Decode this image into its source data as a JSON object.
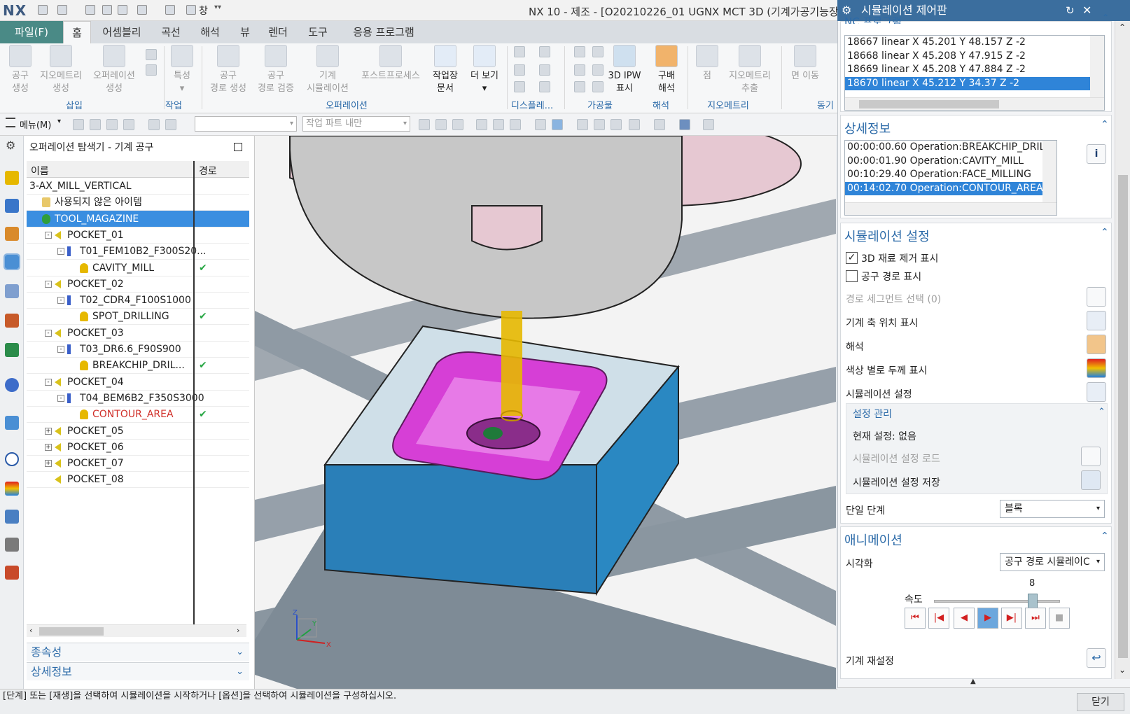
{
  "window": {
    "logo": "NX",
    "window_menu": "창",
    "title": "NX 10 - 제조 - [O20210226_01 UGNX MCT 3D (기계가공기능장 실무)"
  },
  "menu": {
    "file": "파일(F)",
    "tabs": [
      "홈",
      "어셈블리",
      "곡선",
      "해석",
      "뷰",
      "렌더",
      "도구",
      "응용 프로그램"
    ]
  },
  "ribbon": {
    "buttons": [
      {
        "l1": "공구",
        "l2": "생성"
      },
      {
        "l1": "지오메트리",
        "l2": "생성"
      },
      {
        "l1": "오퍼레이션",
        "l2": "생성"
      },
      {
        "l1": "특성",
        "l2": ""
      },
      {
        "l1": "공구",
        "l2": "경로 생성"
      },
      {
        "l1": "공구",
        "l2": "경로 검증"
      },
      {
        "l1": "기계",
        "l2": "시뮬레이션"
      },
      {
        "l1": "포스트프로세스",
        "l2": ""
      },
      {
        "l1": "작업장",
        "l2": "문서"
      },
      {
        "l1": "더 보기",
        "l2": ""
      },
      {
        "l1": "3D IPW",
        "l2": "표시"
      },
      {
        "l1": "구배",
        "l2": "해석"
      },
      {
        "l1": "점",
        "l2": ""
      },
      {
        "l1": "지오메트리",
        "l2": "추출"
      },
      {
        "l1": "면 이동",
        "l2": ""
      }
    ],
    "groups": [
      "삽입",
      "작업",
      "오퍼레이션",
      "디스플레...",
      "가공물",
      "해석",
      "지오메트리",
      "동기"
    ]
  },
  "toolbar": {
    "menu": "메뉴(M)",
    "scope_combo": "작업 파트 내만"
  },
  "navigator": {
    "title": "오퍼레이션 탐색기 - 기계 공구",
    "col_name": "이름",
    "col_path": "경로",
    "rows": [
      {
        "label": "3-AX_MILL_VERTICAL",
        "indent": 0,
        "type": "root"
      },
      {
        "label": "사용되지 않은 아이템",
        "indent": 1,
        "type": "folder"
      },
      {
        "label": "TOOL_MAGAZINE",
        "indent": 1,
        "type": "magazine",
        "selected": true
      },
      {
        "label": "POCKET_01",
        "indent": 2,
        "type": "pocket",
        "toggle": "-"
      },
      {
        "label": "T01_FEM10B2_F300S20...",
        "indent": 3,
        "type": "tool",
        "toggle": "-"
      },
      {
        "label": "CAVITY_MILL",
        "indent": 4,
        "type": "op",
        "check": "✔"
      },
      {
        "label": "POCKET_02",
        "indent": 2,
        "type": "pocket",
        "toggle": "-"
      },
      {
        "label": "T02_CDR4_F100S1000",
        "indent": 3,
        "type": "tool",
        "toggle": "-"
      },
      {
        "label": "SPOT_DRILLING",
        "indent": 4,
        "type": "op",
        "check": "✔"
      },
      {
        "label": "POCKET_03",
        "indent": 2,
        "type": "pocket",
        "toggle": "-"
      },
      {
        "label": "T03_DR6.6_F90S900",
        "indent": 3,
        "type": "tool",
        "toggle": "-"
      },
      {
        "label": "BREAKCHIP_DRIL...",
        "indent": 4,
        "type": "op",
        "check": "✔"
      },
      {
        "label": "POCKET_04",
        "indent": 2,
        "type": "pocket",
        "toggle": "-"
      },
      {
        "label": "T04_BEM6B2_F350S3000",
        "indent": 3,
        "type": "tool",
        "toggle": "-"
      },
      {
        "label": "CONTOUR_AREA",
        "indent": 4,
        "type": "op",
        "check": "✔",
        "red": true
      },
      {
        "label": "POCKET_05",
        "indent": 2,
        "type": "pocket",
        "toggle": "+"
      },
      {
        "label": "POCKET_06",
        "indent": 2,
        "type": "pocket",
        "toggle": "+"
      },
      {
        "label": "POCKET_07",
        "indent": 2,
        "type": "pocket",
        "toggle": "+"
      },
      {
        "label": "POCKET_08",
        "indent": 2,
        "type": "pocket",
        "toggle": ""
      }
    ],
    "dependencies": "종속성",
    "details": "상세정보"
  },
  "status": "[단계] 또는 [재생]을 선택하여 시뮬레이션을 시작하거나 [옵션]을 선택하여 시뮬레이션을 구성하십시오.",
  "panel": {
    "title": "시뮬레이션 제어판",
    "nc_section": "NC 프로그램",
    "nc_rows": [
      "18667 linear X 45.201 Y 48.157 Z -2",
      "18668 linear X 45.208 Y 47.915 Z -2",
      "18669 linear X 45.208 Y 47.884 Z -2",
      "18670 linear X 45.212 Y 34.37 Z -2"
    ],
    "details_title": "상세정보",
    "detail_rows": [
      "00:00:00.60 Operation:BREAKCHIP_DRILLI",
      "00:00:01.90 Operation:CAVITY_MILL",
      "00:10:29.40 Operation:FACE_MILLING",
      "00:14:02.70 Operation:CONTOUR_AREA"
    ],
    "settings_title": "시뮬레이션 설정",
    "show_3d_removal": "3D 재료 제거 표시",
    "show_toolpath": "공구 경로 표시",
    "path_segment": "경로 세그먼트 선택 (0)",
    "machine_axis": "기계 축 위치 표시",
    "analysis": "해석",
    "thickness_color": "색상 별로 두께 표시",
    "sim_settings": "시뮬레이션 설정",
    "settings_mgmt": "설정 관리",
    "current_setting": "현재 설정: 없음",
    "load_settings": "시뮬레이션 설정 로드",
    "save_settings": "시뮬레이션 설정 저장",
    "single_step_label": "단일 단계",
    "single_step_value": "블록",
    "animation_title": "애니메이션",
    "visualize_label": "시각화",
    "visualize_value": "공구 경로 시뮬레이C",
    "speed_label": "속도",
    "speed_value": "8",
    "speed_min": "1",
    "speed_max": "10",
    "speed_fraction": 0.78,
    "machine_reset": "기계 재설정",
    "close": "닫기"
  },
  "axis": {
    "z": "Z",
    "y": "Y",
    "x": "X"
  },
  "colors": {
    "accent": "#2b6aa8",
    "header_blue": "#3b6e9e",
    "file_tab": "#4a8a86",
    "selection": "#2f84d8",
    "check_green": "#28a745",
    "op_red": "#d0302a"
  }
}
